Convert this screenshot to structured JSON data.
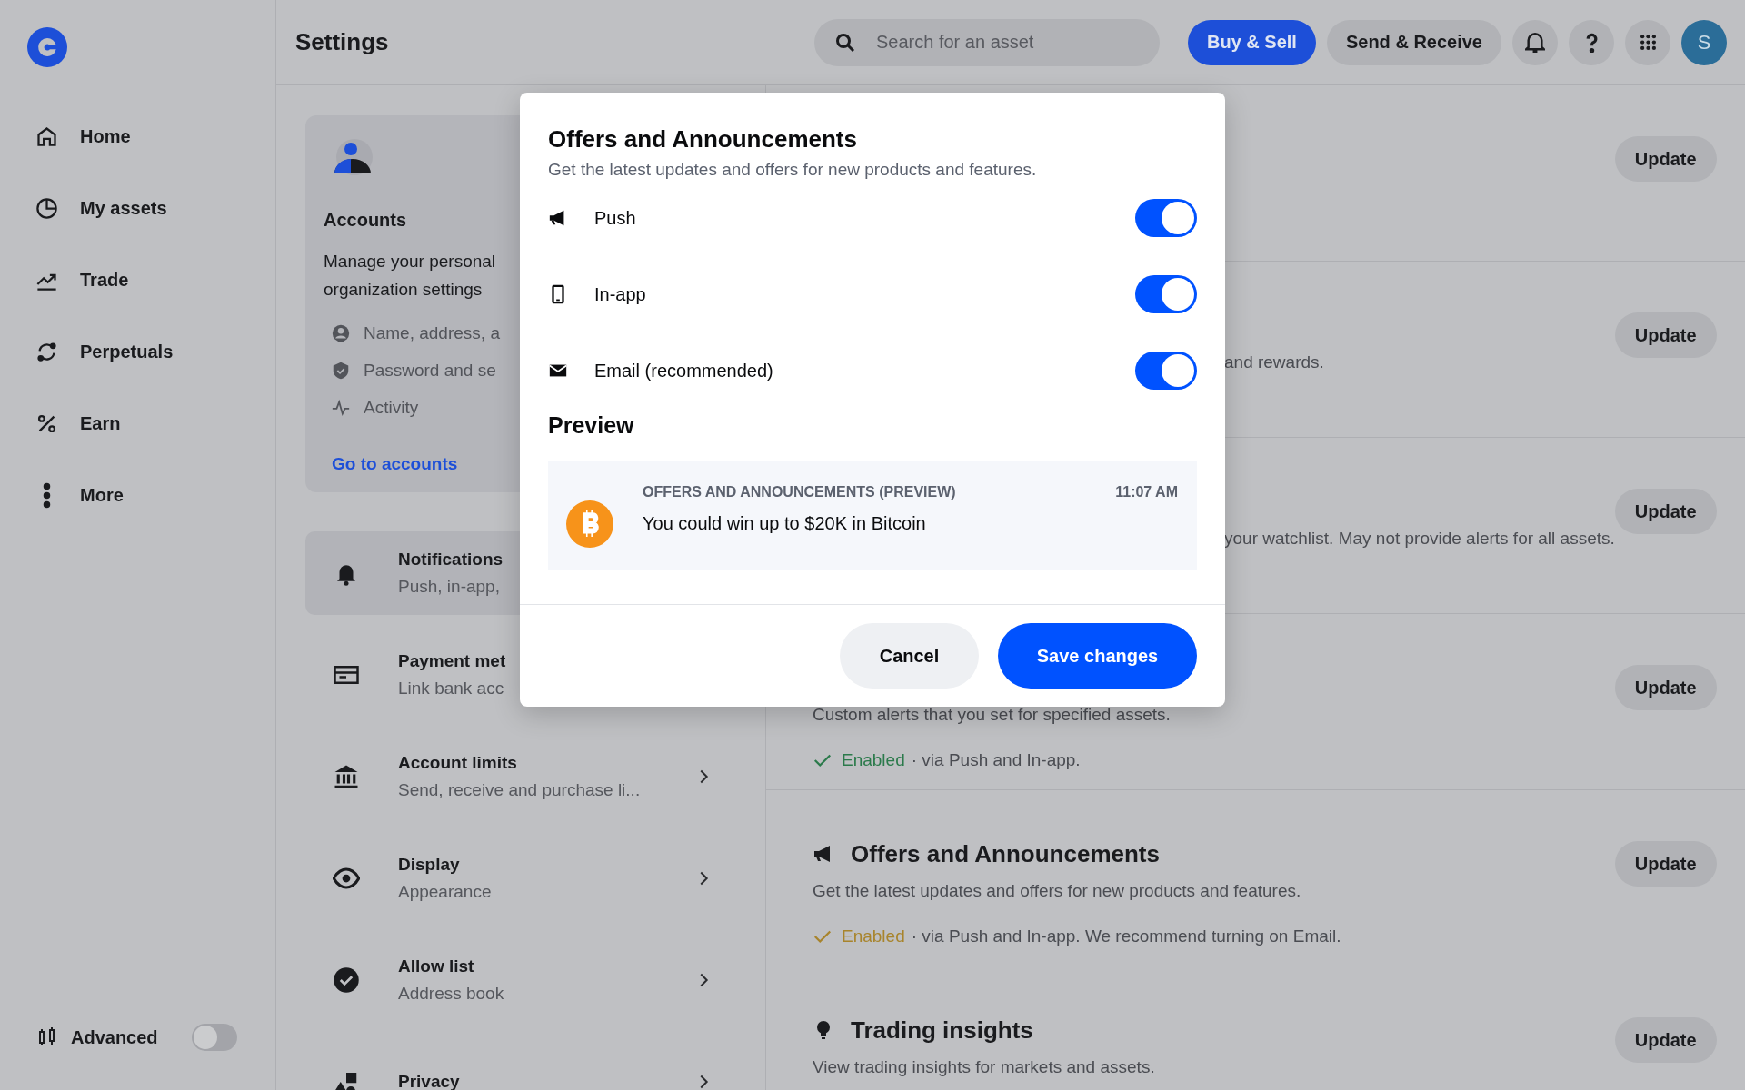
{
  "sidebar": {
    "items": [
      {
        "label": "Home",
        "selected": false
      },
      {
        "label": "My assets",
        "selected": false
      },
      {
        "label": "Trade",
        "selected": false
      },
      {
        "label": "Perpetuals",
        "selected": false
      },
      {
        "label": "Earn",
        "selected": false
      },
      {
        "label": "More",
        "selected": false
      }
    ],
    "advanced": {
      "label": "Advanced",
      "on": false
    }
  },
  "header": {
    "title": "Settings",
    "search": {
      "placeholder": "Search for an asset"
    },
    "buttons": [
      {
        "label": "Buy & Sell",
        "kind": "primary"
      },
      {
        "label": "Send & Receive",
        "kind": "secondary"
      }
    ],
    "avatar": "S"
  },
  "settings_menu": {
    "accounts_card": {
      "title": "Accounts",
      "description_lines": [
        "Manage your personal",
        "organization settings"
      ],
      "links": [
        "Name, address, a",
        "Password and se",
        "Activity"
      ],
      "action": "Go to accounts"
    },
    "items": [
      {
        "title": "Notifications",
        "subtitle": "Push, in-app,",
        "selected": true
      },
      {
        "title": "Payment met",
        "subtitle": "Link bank acc",
        "selected": false
      },
      {
        "title": "Account limits",
        "subtitle": "Send, receive and purchase li...",
        "selected": false,
        "chevron": true
      },
      {
        "title": "Display",
        "subtitle": "Appearance",
        "selected": false,
        "chevron": true
      },
      {
        "title": "Allow list",
        "subtitle": "Address book",
        "selected": false,
        "chevron": true
      },
      {
        "title": "Privacy",
        "selected": false,
        "chevron": true
      }
    ]
  },
  "notification_sections": [
    {
      "button": "Update"
    },
    {
      "description_tail": "and rewards.",
      "button": "Update"
    },
    {
      "description_tail": "your watchlist. May not provide alerts for all assets.",
      "button": "Update"
    },
    {
      "description": "Custom alerts that you set for specified assets.",
      "status": {
        "label": "Enabled",
        "detail": "· via Push and In-app.",
        "color": "#2b7a4b"
      },
      "button": "Update"
    },
    {
      "title": "Offers and Announcements",
      "description": "Get the latest updates and offers for new products and features.",
      "status": {
        "label": "Enabled",
        "detail": "· via Push and In-app. We recommend turning on Email.",
        "color": "#a8842c"
      },
      "button": "Update"
    },
    {
      "title": "Trading insights",
      "description": "View trading insights for markets and assets.",
      "button": "Update"
    }
  ],
  "modal": {
    "title": "Offers and Announcements",
    "subtitle": "Get the latest updates and offers for new products and features.",
    "channels": [
      {
        "label": "Push",
        "on": true
      },
      {
        "label": "In-app",
        "on": true
      },
      {
        "label": "Email (recommended)",
        "on": true
      }
    ],
    "preview": {
      "heading": "Preview",
      "category": "OFFERS AND ANNOUNCEMENTS (PREVIEW)",
      "time": "11:07 AM",
      "message": "You could win up to $20K in Bitcoin"
    },
    "buttons": [
      {
        "label": "Cancel",
        "kind": "secondary"
      },
      {
        "label": "Save changes",
        "kind": "primary"
      }
    ]
  }
}
